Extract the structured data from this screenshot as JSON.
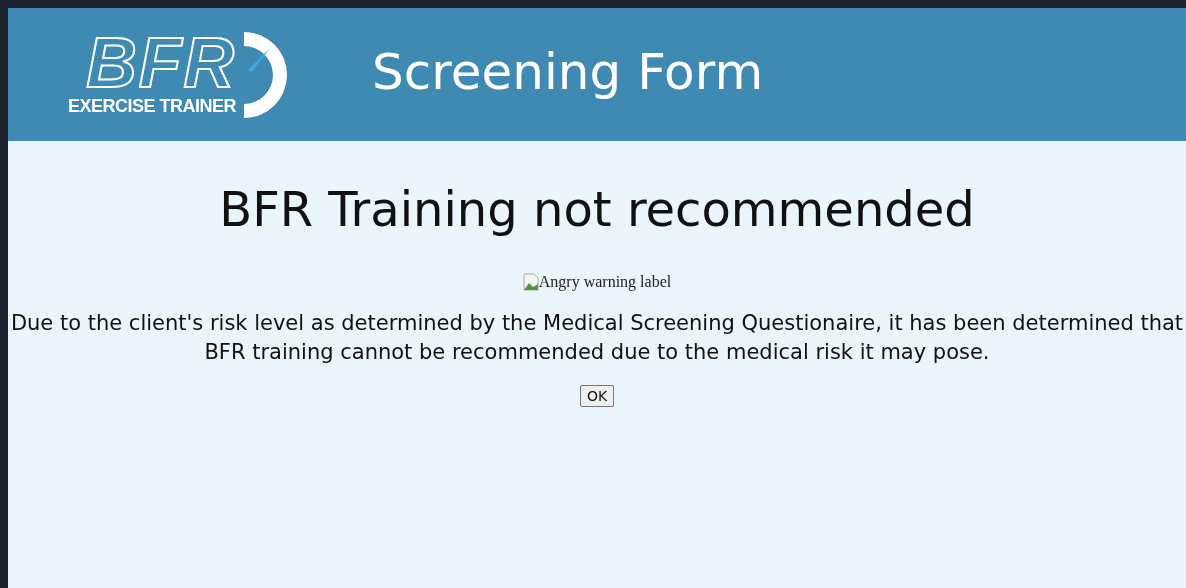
{
  "header": {
    "logo": {
      "wordmark": "BFR",
      "tagline": "EXERCISE TRAINER"
    },
    "title": "Screening Form"
  },
  "content": {
    "heading": "BFR Training not recommended",
    "image_alt": "Angry warning label",
    "message": "Due to the client's risk level as determined by the Medical Screening Questionaire, it has been determined that BFR training cannot be recommended due to the medical risk it may pose.",
    "button": "OK"
  }
}
